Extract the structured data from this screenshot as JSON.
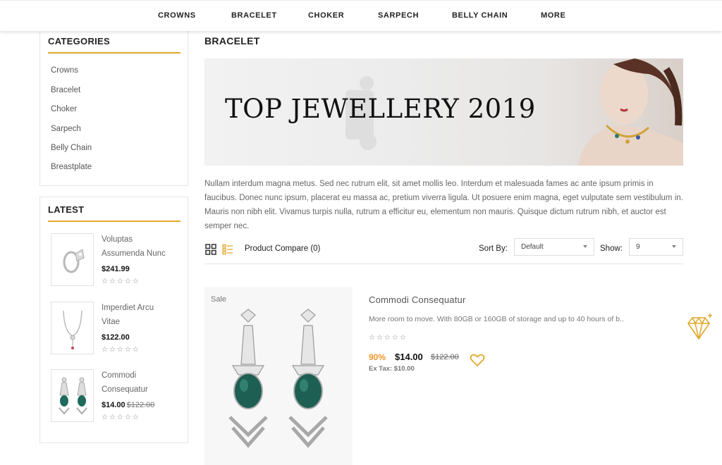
{
  "nav": {
    "items": [
      "CROWNS",
      "BRACELET",
      "CHOKER",
      "SARPECH",
      "BELLY CHAIN",
      "MORE"
    ]
  },
  "categories": {
    "heading": "CATEGORIES",
    "items": [
      "Crowns",
      "Bracelet",
      "Choker",
      "Sarpech",
      "Belly Chain",
      "Breastplate"
    ]
  },
  "latest": {
    "heading": "LATEST",
    "products": [
      {
        "name_line1": "Voluptas",
        "name_line2": "Assumenda Nunc",
        "price": "$241.99",
        "old_price": "",
        "stars": "☆☆☆☆☆"
      },
      {
        "name_line1": "Imperdiet Arcu",
        "name_line2": "Vitae",
        "price": "$122.00",
        "old_price": "",
        "stars": "☆☆☆☆☆"
      },
      {
        "name_line1": "Commodi",
        "name_line2": "Consequatur",
        "price": "$14.00",
        "old_price": "$122.00",
        "stars": "☆☆☆☆☆"
      }
    ]
  },
  "main": {
    "title": "BRACELET",
    "banner_text": "TOP JEWELLERY 2019",
    "description": "Nullam interdum magna metus. Sed nec rutrum elit, sit amet mollis leo. Interdum et malesuada fames ac ante ipsum primis in faucibus. Donec nunc ipsum, placerat eu massa ac, pretium viverra ligula. Ut posuere enim magna, eget vulputate sem vestibulum in. Mauris non nibh elit. Vivamus turpis nulla, rutrum a efficitur eu, elementum non mauris. Quisque dictum rutrum nibh, et auctor est semper nec.",
    "toolbar": {
      "compare": "Product Compare (0)",
      "sort_label": "Sort By:",
      "sort_value": "Default",
      "show_label": "Show:",
      "show_value": "9"
    },
    "product": {
      "sale_label": "Sale",
      "name": "Commodi Consequatur",
      "description": "More room to move. With 80GB or 160GB of storage and up to 40 hours of b..",
      "stars": "☆☆☆☆☆",
      "discount": "90%",
      "price": "$14.00",
      "old_price": "$122.00",
      "tax": "Ex Tax: $10.00"
    }
  },
  "colors": {
    "accent": "#e0a82e",
    "discount": "#f0962a"
  },
  "icons": [
    "grid-view-icon",
    "list-view-icon",
    "heart-icon",
    "diamond-icon",
    "caret-down-icon"
  ]
}
